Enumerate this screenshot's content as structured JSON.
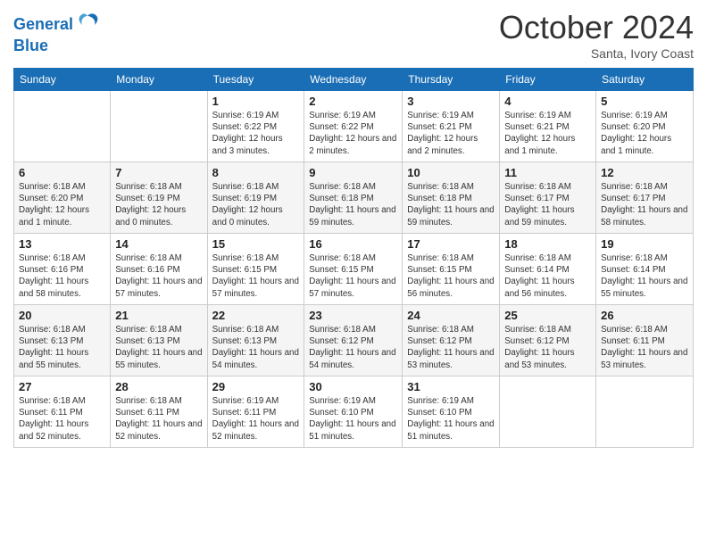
{
  "logo": {
    "line1": "General",
    "line2": "Blue"
  },
  "title": "October 2024",
  "subtitle": "Santa, Ivory Coast",
  "header": {
    "days": [
      "Sunday",
      "Monday",
      "Tuesday",
      "Wednesday",
      "Thursday",
      "Friday",
      "Saturday"
    ]
  },
  "weeks": [
    [
      {
        "day": "",
        "info": ""
      },
      {
        "day": "",
        "info": ""
      },
      {
        "day": "1",
        "info": "Sunrise: 6:19 AM\nSunset: 6:22 PM\nDaylight: 12 hours and 3 minutes."
      },
      {
        "day": "2",
        "info": "Sunrise: 6:19 AM\nSunset: 6:22 PM\nDaylight: 12 hours and 2 minutes."
      },
      {
        "day": "3",
        "info": "Sunrise: 6:19 AM\nSunset: 6:21 PM\nDaylight: 12 hours and 2 minutes."
      },
      {
        "day": "4",
        "info": "Sunrise: 6:19 AM\nSunset: 6:21 PM\nDaylight: 12 hours and 1 minute."
      },
      {
        "day": "5",
        "info": "Sunrise: 6:19 AM\nSunset: 6:20 PM\nDaylight: 12 hours and 1 minute."
      }
    ],
    [
      {
        "day": "6",
        "info": "Sunrise: 6:18 AM\nSunset: 6:20 PM\nDaylight: 12 hours and 1 minute."
      },
      {
        "day": "7",
        "info": "Sunrise: 6:18 AM\nSunset: 6:19 PM\nDaylight: 12 hours and 0 minutes."
      },
      {
        "day": "8",
        "info": "Sunrise: 6:18 AM\nSunset: 6:19 PM\nDaylight: 12 hours and 0 minutes."
      },
      {
        "day": "9",
        "info": "Sunrise: 6:18 AM\nSunset: 6:18 PM\nDaylight: 11 hours and 59 minutes."
      },
      {
        "day": "10",
        "info": "Sunrise: 6:18 AM\nSunset: 6:18 PM\nDaylight: 11 hours and 59 minutes."
      },
      {
        "day": "11",
        "info": "Sunrise: 6:18 AM\nSunset: 6:17 PM\nDaylight: 11 hours and 59 minutes."
      },
      {
        "day": "12",
        "info": "Sunrise: 6:18 AM\nSunset: 6:17 PM\nDaylight: 11 hours and 58 minutes."
      }
    ],
    [
      {
        "day": "13",
        "info": "Sunrise: 6:18 AM\nSunset: 6:16 PM\nDaylight: 11 hours and 58 minutes."
      },
      {
        "day": "14",
        "info": "Sunrise: 6:18 AM\nSunset: 6:16 PM\nDaylight: 11 hours and 57 minutes."
      },
      {
        "day": "15",
        "info": "Sunrise: 6:18 AM\nSunset: 6:15 PM\nDaylight: 11 hours and 57 minutes."
      },
      {
        "day": "16",
        "info": "Sunrise: 6:18 AM\nSunset: 6:15 PM\nDaylight: 11 hours and 57 minutes."
      },
      {
        "day": "17",
        "info": "Sunrise: 6:18 AM\nSunset: 6:15 PM\nDaylight: 11 hours and 56 minutes."
      },
      {
        "day": "18",
        "info": "Sunrise: 6:18 AM\nSunset: 6:14 PM\nDaylight: 11 hours and 56 minutes."
      },
      {
        "day": "19",
        "info": "Sunrise: 6:18 AM\nSunset: 6:14 PM\nDaylight: 11 hours and 55 minutes."
      }
    ],
    [
      {
        "day": "20",
        "info": "Sunrise: 6:18 AM\nSunset: 6:13 PM\nDaylight: 11 hours and 55 minutes."
      },
      {
        "day": "21",
        "info": "Sunrise: 6:18 AM\nSunset: 6:13 PM\nDaylight: 11 hours and 55 minutes."
      },
      {
        "day": "22",
        "info": "Sunrise: 6:18 AM\nSunset: 6:13 PM\nDaylight: 11 hours and 54 minutes."
      },
      {
        "day": "23",
        "info": "Sunrise: 6:18 AM\nSunset: 6:12 PM\nDaylight: 11 hours and 54 minutes."
      },
      {
        "day": "24",
        "info": "Sunrise: 6:18 AM\nSunset: 6:12 PM\nDaylight: 11 hours and 53 minutes."
      },
      {
        "day": "25",
        "info": "Sunrise: 6:18 AM\nSunset: 6:12 PM\nDaylight: 11 hours and 53 minutes."
      },
      {
        "day": "26",
        "info": "Sunrise: 6:18 AM\nSunset: 6:11 PM\nDaylight: 11 hours and 53 minutes."
      }
    ],
    [
      {
        "day": "27",
        "info": "Sunrise: 6:18 AM\nSunset: 6:11 PM\nDaylight: 11 hours and 52 minutes."
      },
      {
        "day": "28",
        "info": "Sunrise: 6:18 AM\nSunset: 6:11 PM\nDaylight: 11 hours and 52 minutes."
      },
      {
        "day": "29",
        "info": "Sunrise: 6:19 AM\nSunset: 6:11 PM\nDaylight: 11 hours and 52 minutes."
      },
      {
        "day": "30",
        "info": "Sunrise: 6:19 AM\nSunset: 6:10 PM\nDaylight: 11 hours and 51 minutes."
      },
      {
        "day": "31",
        "info": "Sunrise: 6:19 AM\nSunset: 6:10 PM\nDaylight: 11 hours and 51 minutes."
      },
      {
        "day": "",
        "info": ""
      },
      {
        "day": "",
        "info": ""
      }
    ]
  ]
}
